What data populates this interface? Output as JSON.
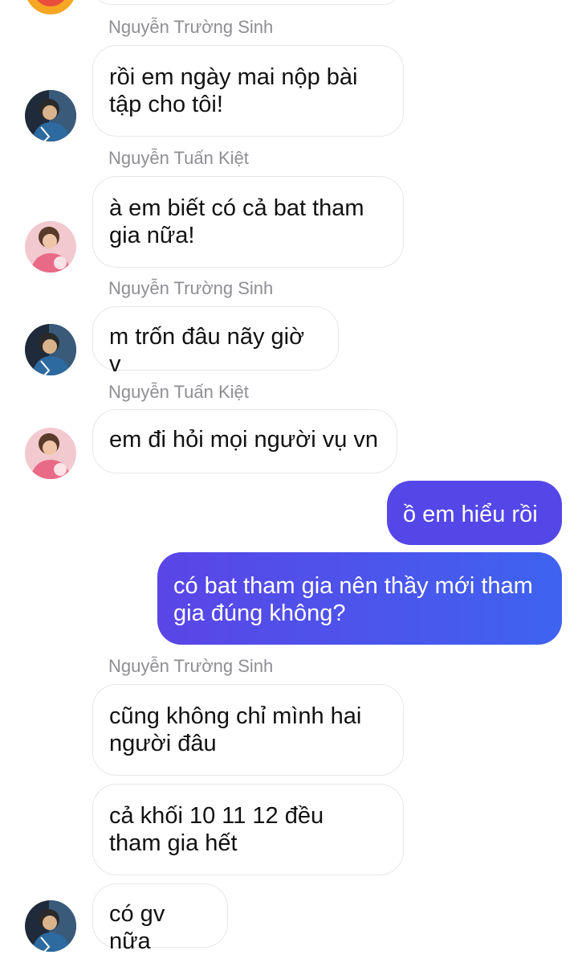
{
  "conversation": {
    "messages": [
      {
        "sender": "Nguyễn Trường Sinh",
        "text": "rồi em ngày mai nộp bài\ntập cho tôi!"
      },
      {
        "sender": "Nguyễn Tuấn Kiệt",
        "text": "à em biết có cả bat tham\ngia nữa!"
      },
      {
        "sender": "Nguyễn Trường Sinh",
        "text": "m trốn đâu nãy giờ v"
      },
      {
        "sender": "Nguyễn Tuấn Kiệt",
        "text": "em đi hỏi mọi người vụ vn"
      },
      {
        "sender": "me",
        "text": "ồ em hiểu rồi"
      },
      {
        "sender": "me",
        "text": "có bat tham gia nên thầy mới tham\ngia đúng không?"
      },
      {
        "sender": "Nguyễn Trường Sinh",
        "text": "cũng không chỉ mình hai\nngười đâu"
      },
      {
        "sender": "Nguyễn Trường Sinh",
        "text": "cả khối 10 11 12 đều\ntham gia hết"
      },
      {
        "sender": "Nguyễn Trường Sinh",
        "text": "có gv nữa"
      }
    ]
  },
  "colors": {
    "outgoing_gradient_start": "#5a45e6",
    "outgoing_gradient_end": "#3f63f0",
    "incoming_bg": "#ffffff",
    "incoming_border": "#e6e6e9",
    "sender_name": "#8e8e93"
  },
  "icons": {
    "avatar_sinh": "avatar-nguyen-truong-sinh",
    "avatar_kiet": "avatar-nguyen-tuan-kiet"
  }
}
